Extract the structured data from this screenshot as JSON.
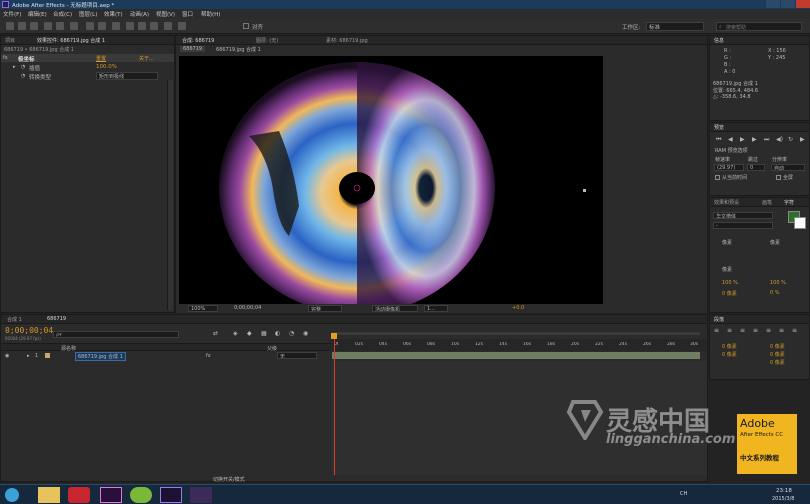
{
  "window": {
    "title": "Adobe After Effects - 无标题项目.aep *"
  },
  "menu": [
    "文件(F)",
    "编辑(E)",
    "合成(C)",
    "图层(L)",
    "效果(T)",
    "动画(A)",
    "视图(V)",
    "窗口",
    "帮助(H)"
  ],
  "toolbar": {
    "snap_label": "对齐",
    "workspace_label": "工作区:",
    "workspace_value": "标准",
    "search_placeholder": "搜索帮助"
  },
  "effects_panel": {
    "tabs": [
      "项目",
      "效果控件: 686719.jpg 合成 1"
    ],
    "breadcrumb": "686719 • 686719.jpg 合成 1",
    "effect_name": "极坐标",
    "reset_label": "重置",
    "about_label": "关于...",
    "prop1_label": "插值",
    "prop1_value": "100.0%",
    "prop2_label": "转换类型",
    "prop2_value": "矩形到极线"
  },
  "viewer": {
    "tabs": [
      "合成: 686719",
      "图层: (无)",
      "素材: 686719.jpg"
    ],
    "subtab": "686719",
    "subtab2": "686719.jpg 合成 1",
    "zoom": "100%",
    "timecode": "0;00;00;04",
    "quality": "完整",
    "camera": "活动摄像机",
    "views": "1...",
    "exposure": "+0.0"
  },
  "info_panel": {
    "title": "信息",
    "r": "R :",
    "g": "G :",
    "b": "B :",
    "a": "A : 0",
    "x": "X : 156",
    "y": "Y : 245",
    "file": "686719.jpg 合成 1",
    "pos": "位置: 665.4, 484.6",
    "delta": "△: -358.6, 34.8"
  },
  "preview_panel": {
    "title": "预览",
    "ram_label": "RAM 预览选项",
    "framerate_label": "帧速率",
    "skip_label": "跳过",
    "res_label": "分辨率",
    "framerate_value": "(29.97)",
    "skip_value": "0",
    "res_value": "自动",
    "from_current": "从当前时间",
    "fullscreen": "全屏"
  },
  "char_panel": {
    "tabs": [
      "效果和预设",
      "画笔",
      "字符"
    ],
    "font": "华文楷体",
    "font_style": "-",
    "size1": "像素",
    "size2": "像素",
    "size3": "像素",
    "pct1": "100 %",
    "pct2": "100 %",
    "px1": "0 像素",
    "px2": "0 %"
  },
  "paragraph_panel": {
    "title": "段落",
    "v1": "0 像素",
    "v2": "0 像素",
    "v3": "0 像素",
    "v4": "0 像素",
    "v5": "0 像素"
  },
  "timeline": {
    "tabs": [
      "合成 1",
      "686719"
    ],
    "timecode": "0;00;00;04",
    "fps": "00004 (29.97 fps)",
    "search_placeholder": "ρ▾",
    "col_source": "源名称",
    "col_parent": "父级",
    "layer_num": "1",
    "layer_name": "686719.jpg 合成 1",
    "layer_parent": "无",
    "ruler": [
      "0f",
      "02s",
      "04s",
      "06s",
      "08s",
      "10s",
      "12s",
      "14s",
      "16s",
      "18s",
      "20s",
      "22s",
      "24s",
      "26s",
      "28s",
      "30s"
    ],
    "footer": "切换开关/模式"
  },
  "taskbar": {
    "time": "23:18",
    "date": "2015/3/8",
    "lang": "CH"
  },
  "watermark": {
    "brand_cn": "灵感中国",
    "brand_en": "lingganchina.com",
    "badge_title": "Adobe",
    "badge_sub": "After Effects CC",
    "badge_cn": "中文系列教程"
  },
  "colors": {
    "accent": "#d29a2a",
    "taskbar": "#16283c",
    "viewer_bg": "#000000"
  }
}
